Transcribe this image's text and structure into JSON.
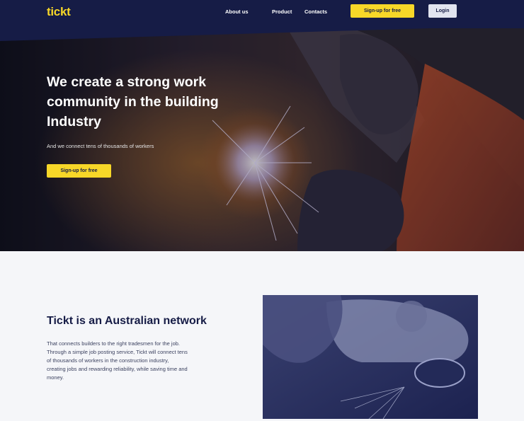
{
  "header": {
    "logo": "tickt",
    "nav": [
      "About us",
      "Product",
      "Contacts"
    ],
    "signup_label": "Sign-up for free",
    "login_label": "Login"
  },
  "hero": {
    "title": "We create a strong work community in the building Industry",
    "subtitle": "And we connect tens of thousands of workers",
    "signup_label": "Sign-up for free"
  },
  "about": {
    "title": "Tickt is an Australian network",
    "text": "That connects builders to the right tradesmen for the job. Through a simple job posting service, Tickt will connect tens of thousands of workers in the construction industry, creating jobs and rewarding reliability, while saving time and money."
  },
  "colors": {
    "navy": "#161c46",
    "yellow": "#f7d728",
    "light_bg": "#f5f6f9",
    "login_bg": "#e1e4ef"
  }
}
